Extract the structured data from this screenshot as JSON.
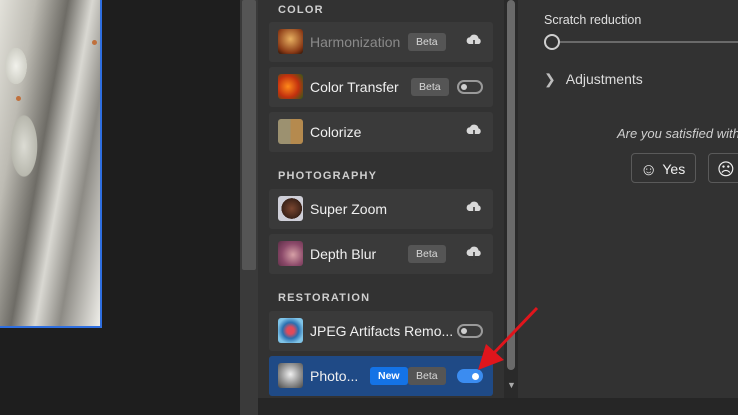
{
  "sections": [
    {
      "heading": "COLOR"
    },
    {
      "heading": "PHOTOGRAPHY"
    },
    {
      "heading": "RESTORATION"
    }
  ],
  "filters": [
    {
      "label": "Harmonization",
      "badge": "Beta",
      "control": "cloud-download-icon",
      "disabled": true
    },
    {
      "label": "Color Transfer",
      "badge": "Beta",
      "control": "toggle",
      "toggle_on": false
    },
    {
      "label": "Colorize",
      "control": "cloud-download-icon"
    },
    {
      "label": "Super Zoom",
      "control": "cloud-download-icon"
    },
    {
      "label": "Depth Blur",
      "badge": "Beta",
      "control": "cloud-download-icon"
    },
    {
      "label": "JPEG Artifacts Remo...",
      "control": "toggle",
      "toggle_on": false
    },
    {
      "label": "Photo...",
      "badge_new": "New",
      "badge": "Beta",
      "control": "toggle",
      "toggle_on": true,
      "selected": true
    }
  ],
  "settings": {
    "scratch_reduction_label": "Scratch reduction",
    "adjustments_label": "Adjustments",
    "satisfied_prompt": "Are you satisfied with t",
    "yes_label": "Yes"
  },
  "colors": {
    "accent": "#1473e6",
    "selected_row": "#1f4a86",
    "arrow": "#e0151c",
    "image_border": "#2f6fe0"
  }
}
